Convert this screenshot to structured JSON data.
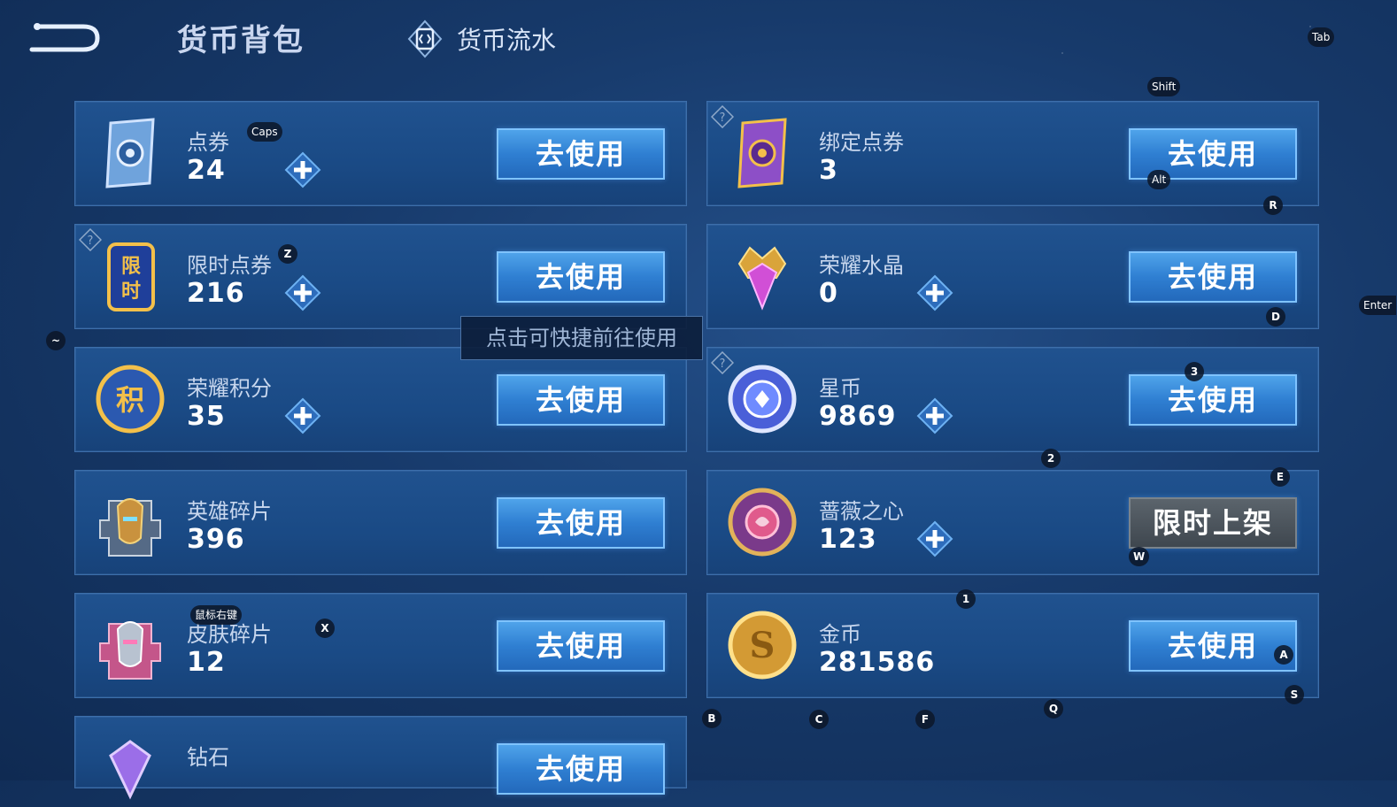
{
  "header": {
    "title": "货币背包",
    "flow_label": "货币流水"
  },
  "tooltip": "点击可快捷前往使用",
  "cards_left": [
    {
      "name": "点券",
      "amount": "24",
      "button": "去使用"
    },
    {
      "name": "限时点券",
      "amount": "216",
      "button": "去使用"
    },
    {
      "name": "荣耀积分",
      "amount": "35",
      "button": "去使用"
    },
    {
      "name": "英雄碎片",
      "amount": "396",
      "button": "去使用"
    },
    {
      "name": "皮肤碎片",
      "amount": "12",
      "button": "去使用"
    },
    {
      "name": "钻石",
      "amount": "",
      "button": "去使用"
    }
  ],
  "cards_right": [
    {
      "name": "绑定点券",
      "amount": "3",
      "button": "去使用"
    },
    {
      "name": "荣耀水晶",
      "amount": "0",
      "button": "去使用"
    },
    {
      "name": "星币",
      "amount": "9869",
      "button": "去使用"
    },
    {
      "name": "蔷薇之心",
      "amount": "123",
      "button": "限时上架"
    },
    {
      "name": "金币",
      "amount": "281586",
      "button": "去使用"
    }
  ],
  "hotkeys": {
    "tab": "Tab",
    "shift": "Shift",
    "caps": "Caps",
    "alt": "Alt",
    "r": "R",
    "z": "Z",
    "tilde": "~",
    "d": "D",
    "enter": "Enter",
    "three": "3",
    "two": "2",
    "e": "E",
    "w": "W",
    "one": "1",
    "right_click": "鼠标右键",
    "x": "X",
    "a": "A",
    "s": "S",
    "b": "B",
    "c": "C",
    "f": "F",
    "q": "Q"
  },
  "colors": {
    "accent_blue": "#2f7fd2",
    "card_bg": "#1a4a85",
    "disabled_button": "#3f474f"
  }
}
